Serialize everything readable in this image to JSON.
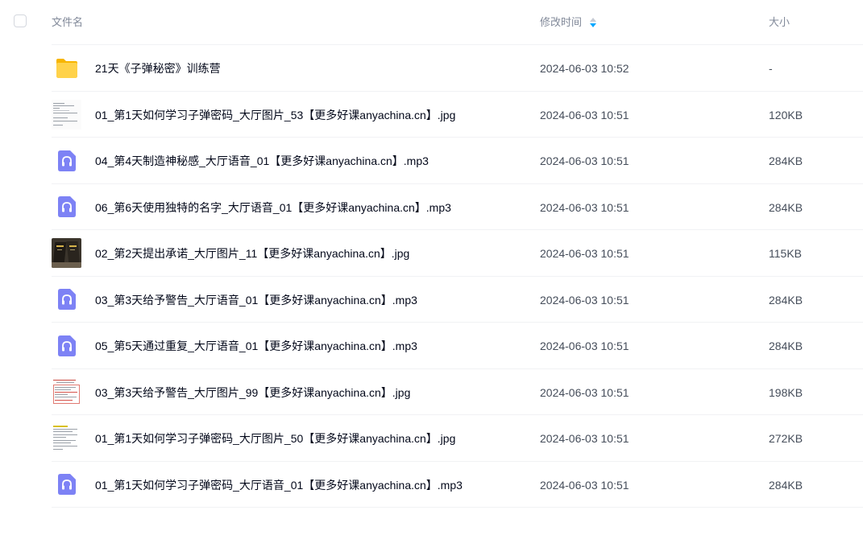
{
  "header": {
    "name_label": "文件名",
    "time_label": "修改时间",
    "size_label": "大小"
  },
  "colors": {
    "folder": "#ffc83d",
    "audio": "#7d82f5",
    "sort_active": "#06a7ff"
  },
  "rows": [
    {
      "icon": "folder-icon",
      "name": "21天《子弹秘密》训练营",
      "time": "2024-06-03 10:52",
      "size": "-"
    },
    {
      "icon": "image-thumbnail",
      "name": "01_第1天如何学习子弹密码_大厅图片_53【更多好课anyachina.cn】.jpg",
      "time": "2024-06-03 10:51",
      "size": "120KB"
    },
    {
      "icon": "audio-file-icon",
      "name": "04_第4天制造神秘感_大厅语音_01【更多好课anyachina.cn】.mp3",
      "time": "2024-06-03 10:51",
      "size": "284KB"
    },
    {
      "icon": "audio-file-icon",
      "name": "06_第6天使用独特的名字_大厅语音_01【更多好课anyachina.cn】.mp3",
      "time": "2024-06-03 10:51",
      "size": "284KB"
    },
    {
      "icon": "image-thumbnail",
      "name": "02_第2天提出承诺_大厅图片_11【更多好课anyachina.cn】.jpg",
      "time": "2024-06-03 10:51",
      "size": "115KB"
    },
    {
      "icon": "audio-file-icon",
      "name": "03_第3天给予警告_大厅语音_01【更多好课anyachina.cn】.mp3",
      "time": "2024-06-03 10:51",
      "size": "284KB"
    },
    {
      "icon": "audio-file-icon",
      "name": "05_第5天通过重复_大厅语音_01【更多好课anyachina.cn】.mp3",
      "time": "2024-06-03 10:51",
      "size": "284KB"
    },
    {
      "icon": "image-thumbnail",
      "name": "03_第3天给予警告_大厅图片_99【更多好课anyachina.cn】.jpg",
      "time": "2024-06-03 10:51",
      "size": "198KB"
    },
    {
      "icon": "image-thumbnail",
      "name": "01_第1天如何学习子弹密码_大厅图片_50【更多好课anyachina.cn】.jpg",
      "time": "2024-06-03 10:51",
      "size": "272KB"
    },
    {
      "icon": "audio-file-icon",
      "name": "01_第1天如何学习子弹密码_大厅语音_01【更多好课anyachina.cn】.mp3",
      "time": "2024-06-03 10:51",
      "size": "284KB"
    }
  ]
}
